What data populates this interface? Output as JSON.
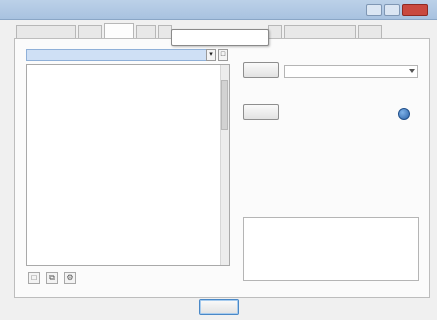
{
  "window": {
    "title": ""
  },
  "tabs": [
    {
      "label": ""
    },
    {
      "label": ""
    },
    {
      "label": ""
    },
    {
      "label": ""
    },
    {
      "label": ""
    },
    {
      "label": ""
    },
    {
      "label": ""
    },
    {
      "label": ""
    }
  ],
  "tooltip": {
    "text": ""
  },
  "left_panel": {
    "combo_value": "",
    "columns": [
      "",
      ""
    ],
    "rows": [
      [
        "",
        ""
      ],
      [
        "",
        ""
      ],
      [
        "",
        ""
      ],
      [
        "",
        ""
      ],
      [
        "",
        ""
      ],
      [
        "",
        ""
      ],
      [
        "",
        ""
      ],
      [
        "",
        ""
      ],
      [
        "",
        ""
      ],
      [
        "",
        ""
      ],
      [
        "",
        ""
      ],
      [
        "",
        ""
      ],
      [
        "",
        ""
      ],
      [
        "",
        ""
      ],
      [
        "",
        ""
      ],
      [
        "",
        ""
      ],
      [
        "",
        ""
      ],
      [
        "",
        ""
      ],
      [
        "",
        ""
      ]
    ]
  },
  "right_panel": {
    "field_group_label": "",
    "first_button": "",
    "second_button": "",
    "option_label": "",
    "description_label": ""
  },
  "footer": {
    "main_button": ""
  },
  "icons": {
    "toolbar": [
      "new-icon",
      "copy-icon",
      "settings-icon"
    ],
    "option": "globe-icon"
  }
}
